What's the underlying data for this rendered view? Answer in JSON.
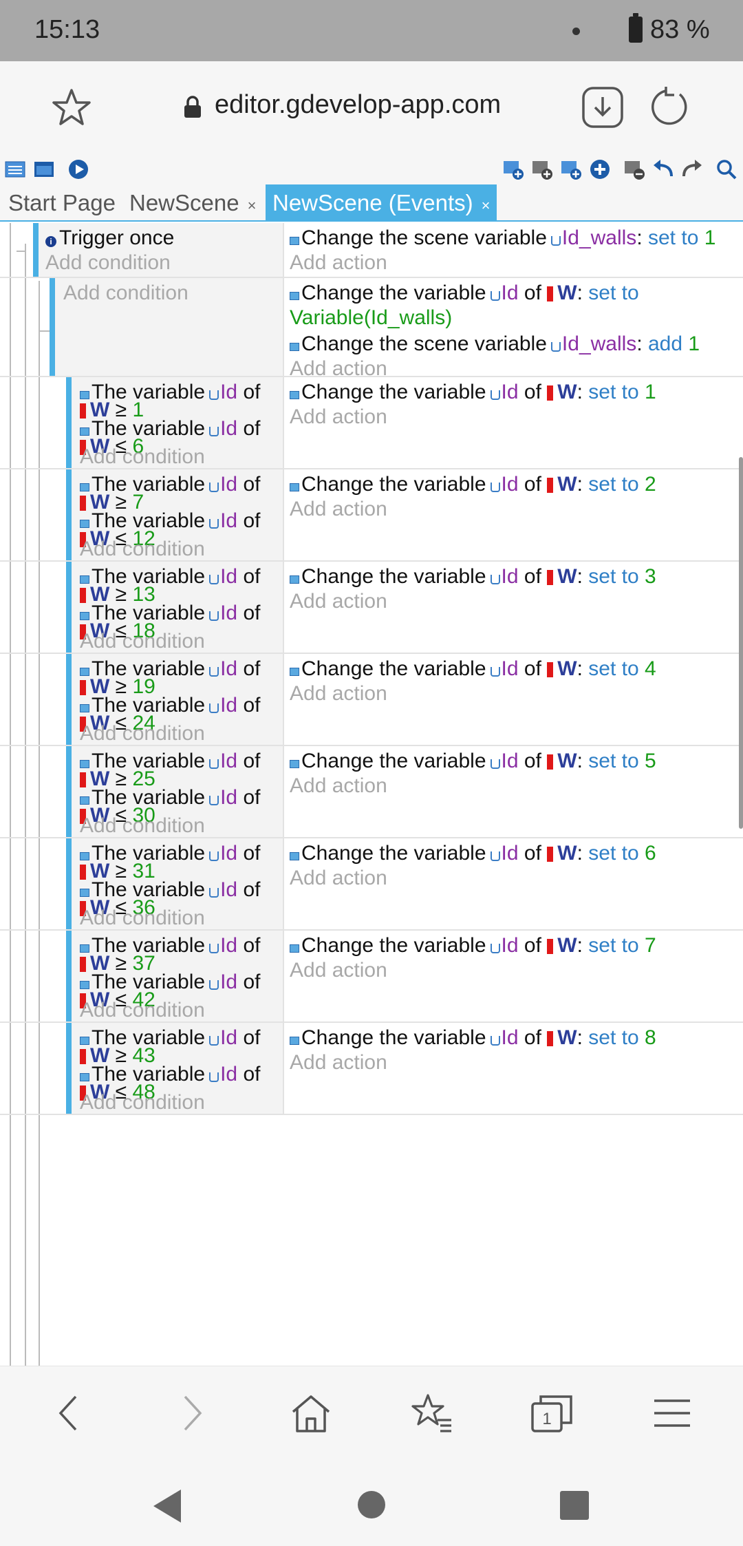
{
  "status_bar": {
    "time": "15:13",
    "battery": "83 %"
  },
  "browser": {
    "url": "editor.gdevelop-app.com"
  },
  "tabs": [
    {
      "label": "Start Page"
    },
    {
      "label": "NewScene",
      "close": "×"
    },
    {
      "label": "NewScene (Events)",
      "close": "×"
    }
  ],
  "placeholders": {
    "add_condition": "Add condition",
    "add_action": "Add action"
  },
  "text": {
    "trigger_once": "Trigger once",
    "change_scene_var": "Change the scene variable",
    "change_var": "Change the variable",
    "the_variable": "The variable",
    "of": "of",
    "var_id": "Id",
    "var_id_walls": "Id_walls",
    "object_w": "W",
    "set_to": "set to",
    "add": "add",
    "variable_expr": "Variable(Id_walls)",
    "gte": "≥",
    "lte": "≤",
    "colon": ":"
  },
  "top_event": {
    "action_value": "1"
  },
  "second_event": {
    "add_value": "1"
  },
  "range_events": [
    {
      "min": "1",
      "max": "6",
      "set": "1"
    },
    {
      "min": "7",
      "max": "12",
      "set": "2"
    },
    {
      "min": "13",
      "max": "18",
      "set": "3"
    },
    {
      "min": "19",
      "max": "24",
      "set": "4"
    },
    {
      "min": "25",
      "max": "30",
      "set": "5"
    },
    {
      "min": "31",
      "max": "36",
      "set": "6"
    },
    {
      "min": "37",
      "max": "42",
      "set": "7"
    },
    {
      "min": "43",
      "max": "48",
      "set": "8"
    }
  ],
  "colors": {
    "accent": "#4ab0e4",
    "variable": "#8a2ea3",
    "keyword": "#2f7fc6",
    "value": "#189b18",
    "object": "#2c3e99"
  }
}
